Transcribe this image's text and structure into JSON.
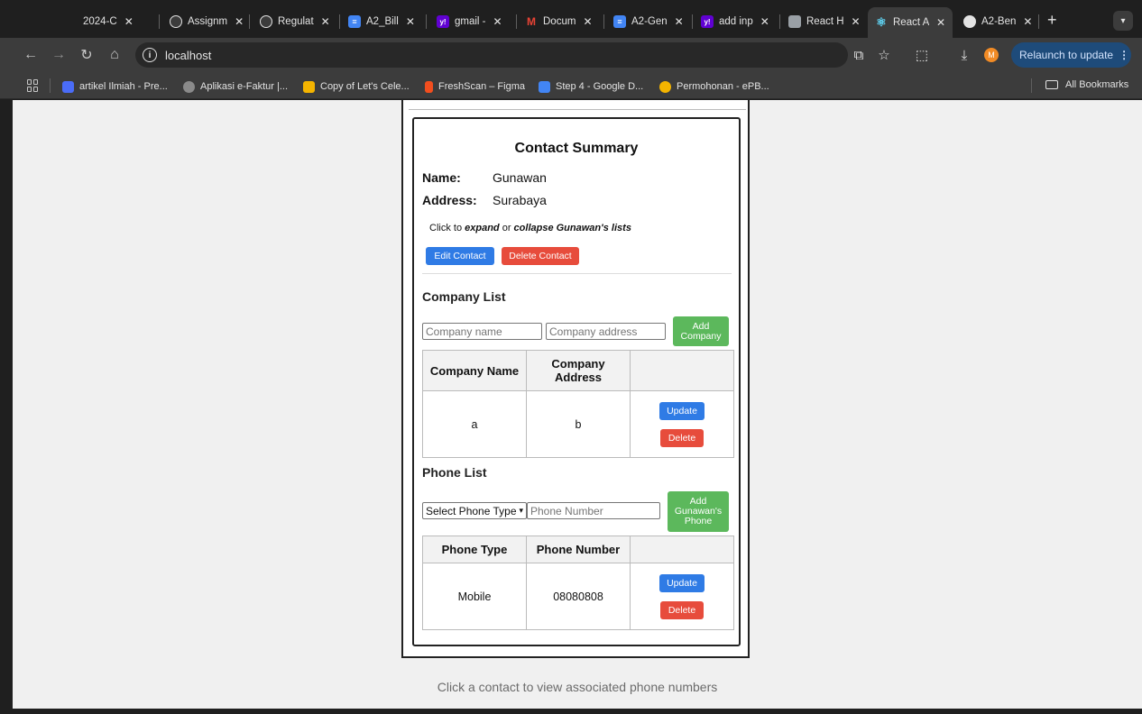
{
  "browser": {
    "tabs": [
      {
        "title": "2024-C",
        "favicon_color": "#1f1f1f",
        "favicon_glyph": "·"
      },
      {
        "title": "Assignm",
        "favicon_color": "#3c3c3c",
        "favicon_glyph": "◍"
      },
      {
        "title": "Regulat",
        "favicon_color": "#3c3c3c",
        "favicon_glyph": "◍"
      },
      {
        "title": "A2_Bill",
        "favicon_color": "#4285f4",
        "favicon_glyph": "≡"
      },
      {
        "title": "gmail -",
        "favicon_color": "#6001d2",
        "favicon_glyph": "y!"
      },
      {
        "title": "Docum",
        "favicon_color": "#1f1f1f",
        "favicon_glyph": "M"
      },
      {
        "title": "A2-Gen",
        "favicon_color": "#4285f4",
        "favicon_glyph": "≡"
      },
      {
        "title": "add inp",
        "favicon_color": "#6001d2",
        "favicon_glyph": "y!"
      },
      {
        "title": "React H",
        "favicon_color": "#9aa0a6",
        "favicon_glyph": "▣"
      },
      {
        "title": "React A",
        "favicon_color": "#3c3c3c",
        "favicon_glyph": "⚛"
      },
      {
        "title": "A2-Ben",
        "favicon_color": "#1f1f1f",
        "favicon_glyph": "●"
      }
    ],
    "address": "localhost",
    "relaunch_label": "Relaunch to update",
    "profile_initial": "M",
    "bookmarks": [
      {
        "title": "artikel Ilmiah - Pre...",
        "color": "#4a6cf7"
      },
      {
        "title": "Aplikasi e-Faktur |...",
        "color": "#8a8a8a"
      },
      {
        "title": "Copy of Let's Cele...",
        "color": "#f4b400"
      },
      {
        "title": "FreshScan – Figma",
        "color": "#f24e1e"
      },
      {
        "title": "Step 4 - Google D...",
        "color": "#4285f4"
      },
      {
        "title": "Permohonan - ePB...",
        "color": "#f4b400"
      }
    ],
    "all_bookmarks_label": "All Bookmarks"
  },
  "contact": {
    "heading": "Contact Summary",
    "name_label": "Name:",
    "name_value": "Gunawan",
    "address_label": "Address:",
    "address_value": "Surabaya",
    "hint_prefix": "Click to ",
    "hint_expand": "expand",
    "hint_or": " or ",
    "hint_collapse": "collapse Gunawan's lists",
    "edit_label": "Edit Contact",
    "delete_label": "Delete Contact"
  },
  "company": {
    "section_title": "Company List",
    "name_placeholder": "Company name",
    "address_placeholder": "Company address",
    "add_label": "Add Company",
    "headers": [
      "Company Name",
      "Company Address",
      ""
    ],
    "rows": [
      {
        "name": "a",
        "address": "b",
        "update_label": "Update",
        "delete_label": "Delete"
      }
    ]
  },
  "phone": {
    "section_title": "Phone List",
    "type_selected": "Select Phone Type",
    "number_placeholder": "Phone Number",
    "add_label": "Add Gunawan's Phone",
    "headers": [
      "Phone Type",
      "Phone Number",
      ""
    ],
    "rows": [
      {
        "type": "Mobile",
        "number": "08080808",
        "update_label": "Update",
        "delete_label": "Delete"
      }
    ]
  },
  "footer_text": "Click a contact to view associated phone numbers"
}
